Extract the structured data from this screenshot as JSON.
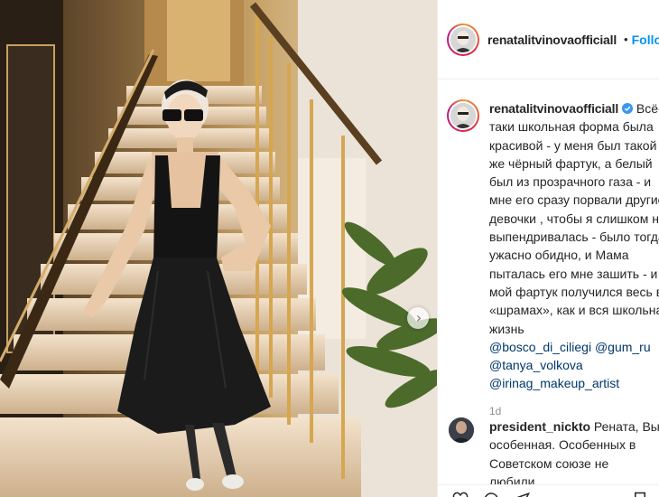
{
  "post": {
    "username": "renatalitvinovaofficiall",
    "follow_label": "Follow",
    "dot": "•",
    "caption": "Всё-таки школьная форма была красивой - у меня был такой же чёрный фартук, а белый был из прозрачного газа - и мне его сразу порвали другие девочки , чтобы я слишком не выпендривалась - было тогда ужасно обидно, и Мама пыталась его мне зашить - и мой фартук получился весь в «шрамах», как и вся школьная жизнь",
    "tags_line1": "@bosco_di_ciliegi @gum_ru",
    "tags_line2": "@tanya_volkova",
    "tags_line3": "@irinag_makeup_artist",
    "time": "1d",
    "next_arrow": "›"
  },
  "comment": {
    "username": "president_nickto",
    "text": "Рената, Вы особенная. Особенных в Советском союзе не любили,"
  },
  "colors": {
    "link": "#00376b",
    "follow": "#0095f6",
    "verified": "#3897f0",
    "text": "#262626",
    "muted": "#8e8e8e"
  },
  "icons": [
    "verified-badge-icon",
    "chevron-right-icon",
    "heart-icon",
    "comment-icon",
    "share-icon",
    "bookmark-icon"
  ]
}
